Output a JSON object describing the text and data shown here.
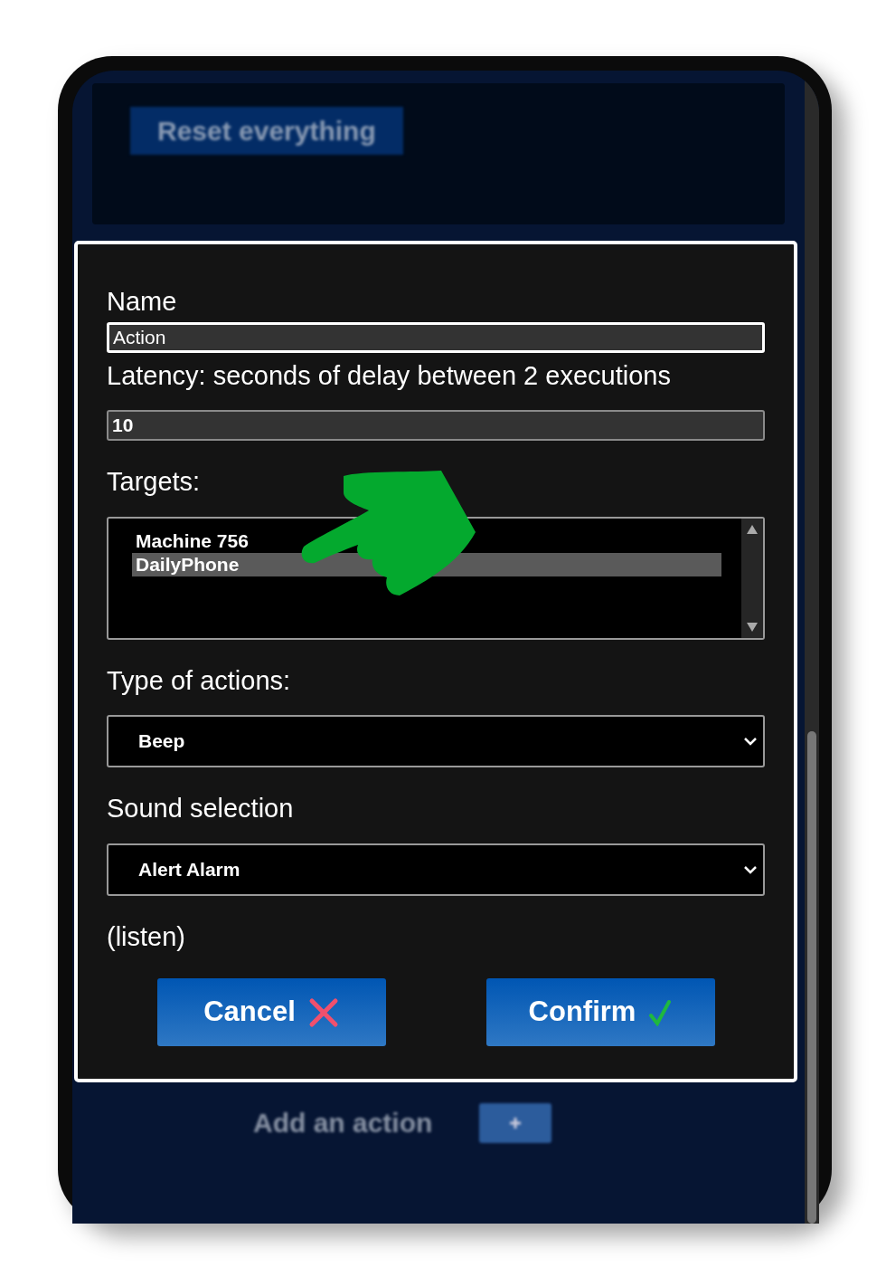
{
  "background": {
    "reset_button": "Reset everything",
    "add_label": "Add an action"
  },
  "dialog": {
    "name": {
      "label": "Name",
      "value": "Action",
      "focused": true
    },
    "latency": {
      "label": "Latency: seconds of delay between 2 executions",
      "value": "10"
    },
    "targets": {
      "label": "Targets:",
      "items": [
        {
          "label": "Machine 756",
          "selected": false
        },
        {
          "label": "DailyPhone",
          "selected": true
        }
      ]
    },
    "action_type": {
      "label": "Type of actions:",
      "value": "Beep"
    },
    "sound": {
      "label": "Sound selection",
      "value": "Alert Alarm"
    },
    "listen_link": "(listen)",
    "buttons": [
      {
        "label": "Cancel",
        "kind": "cancel"
      },
      {
        "label": "Confirm",
        "kind": "confirm"
      }
    ]
  }
}
